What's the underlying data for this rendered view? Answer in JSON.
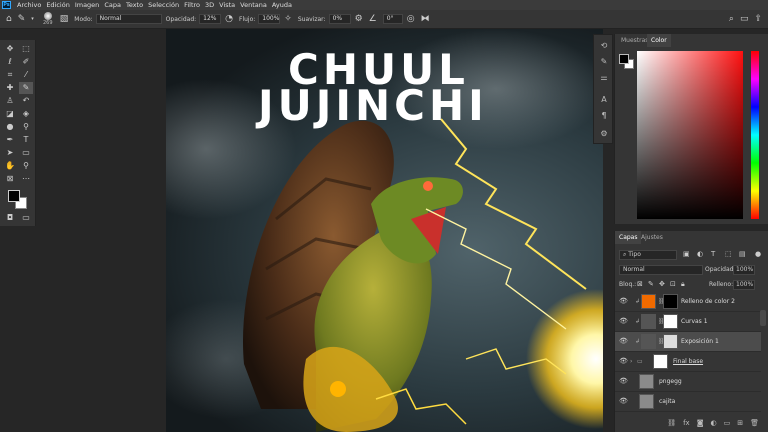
{
  "menubar": {
    "items": [
      "Archivo",
      "Edición",
      "Imagen",
      "Capa",
      "Texto",
      "Selección",
      "Filtro",
      "3D",
      "Vista",
      "Ventana",
      "Ayuda"
    ]
  },
  "options": {
    "brush_size": "269",
    "mode_label": "Modo:",
    "mode_value": "Normal",
    "opacity_label": "Opacidad:",
    "opacity_value": "12%",
    "flow_label": "Flujo:",
    "flow_value": "100%",
    "smooth_label": "Suavizar:",
    "smooth_value": "0%",
    "angle_value": "0°"
  },
  "canvas": {
    "title_line1": "CHUUL",
    "title_line2": "JUJINCHI"
  },
  "color_panel": {
    "tabs": [
      "Muestras",
      "Color"
    ]
  },
  "layers_panel": {
    "tabs": [
      "Capas",
      "Ajustes"
    ],
    "filter": "Tipo",
    "blend_mode": "Normal",
    "opacity_label": "Opacidad:",
    "opacity_value": "100%",
    "lock_label": "Bloq.:",
    "fill_label": "Relleno:",
    "fill_value": "100%",
    "layers": [
      {
        "name": "Relleno de color 2",
        "thumb": "#f06a00",
        "selected": false
      },
      {
        "name": "Curvas 1",
        "thumb": "#ffffff",
        "selected": false
      },
      {
        "name": "Exposición 1",
        "thumb": "#ffffff",
        "selected": true
      },
      {
        "name": "Final base",
        "thumb": "#ffffff",
        "selected": false
      },
      {
        "name": "pngegg",
        "thumb": "#999999",
        "selected": false
      },
      {
        "name": "cajita",
        "thumb": "#999999",
        "selected": false
      }
    ]
  }
}
